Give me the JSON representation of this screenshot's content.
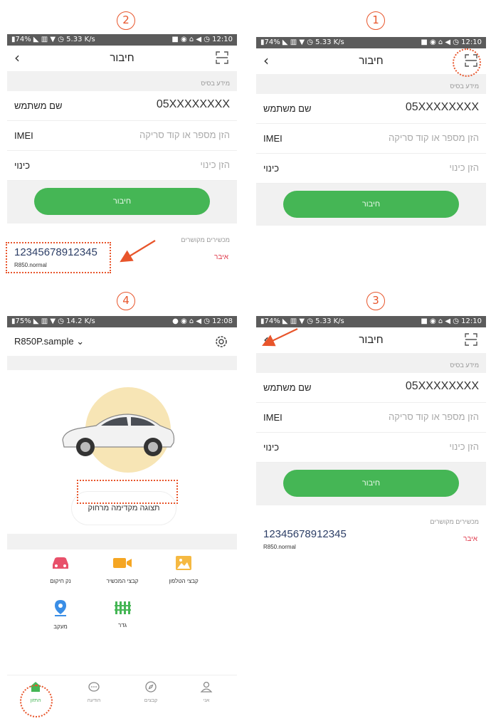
{
  "steps": [
    "1",
    "2",
    "3",
    "4"
  ],
  "status_bar": {
    "left": "▮74% ◣ ▥ ▼ ◷ 5.33 K/s",
    "right": "■ ◉ ⌂ ◀ ◷ 12:10",
    "left_p4": "▮75% ◣ ▥ ▼ ◷ 14.2 K/s",
    "right_p4": "● ◉ ⌂ ◀ ◷ 12:08"
  },
  "connect": {
    "title": "חיבור",
    "section_basic": "מידע בסיס",
    "username_label": "שם משתמש",
    "username_value": "05XXXXXXXX",
    "imei_label": "IMEI",
    "imei_placeholder": "הזן מספר או קוד סריקה",
    "nickname_label": "כינוי",
    "nickname_placeholder": "הזן כינוי",
    "connect_button": "חיבור",
    "linked_label": "מכשירים מקושרים",
    "device_id": "12345678912345",
    "device_model": "R850.normal",
    "remove": "איבר"
  },
  "home": {
    "device_selector": "R850P.sample ⌄",
    "preview_button": "תצוגה מקדימה מרחוק",
    "functions": [
      {
        "label": "נק חיקום",
        "icon": "car-icon",
        "color": "#e8506a"
      },
      {
        "label": "קבצי המכשיר",
        "icon": "video-icon",
        "color": "#f5a623"
      },
      {
        "label": "קבצי הטלפון",
        "icon": "image-icon",
        "color": "#f5b942"
      },
      {
        "label": "מעקב",
        "icon": "location-pin-icon",
        "color": "#3a8ee6"
      },
      {
        "label": "גדר",
        "icon": "fence-icon",
        "color": "#45b655"
      }
    ],
    "tabs": [
      {
        "label": "התזון",
        "icon": "home-icon"
      },
      {
        "label": "הודעה",
        "icon": "message-icon"
      },
      {
        "label": "קבצים",
        "icon": "compass-icon"
      },
      {
        "label": "אני",
        "icon": "user-icon"
      }
    ]
  }
}
